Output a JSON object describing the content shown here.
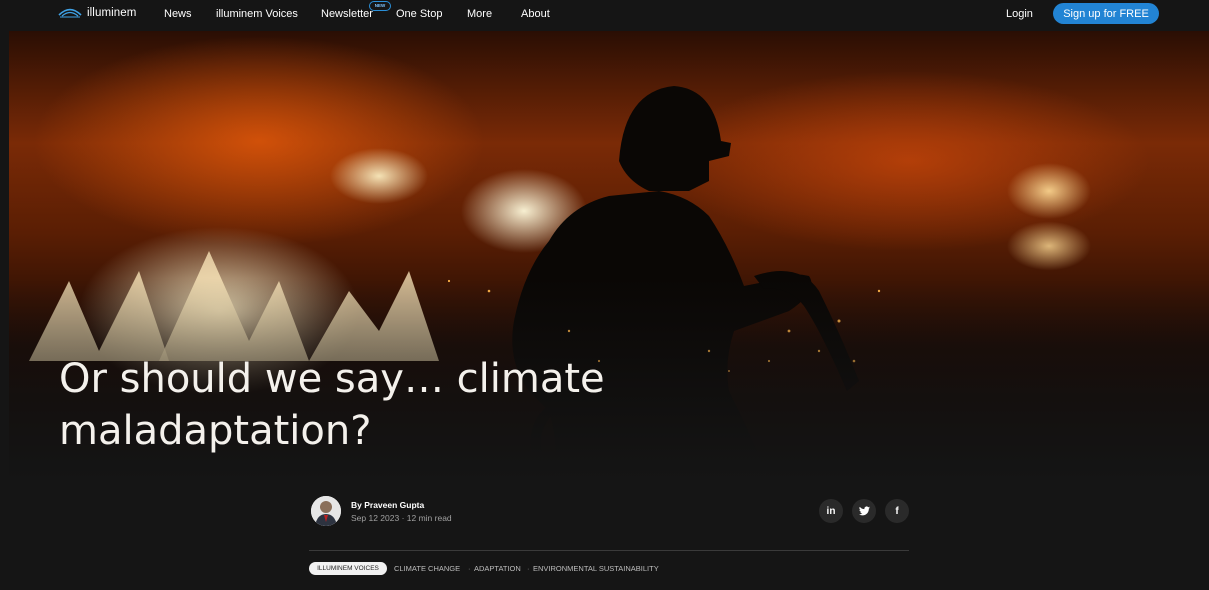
{
  "nav": {
    "logo_text": "illuminem",
    "items": [
      "News",
      "illuminem Voices",
      "Newsletter",
      "One Stop",
      "More",
      "About"
    ],
    "new_badge": "NEW",
    "login": "Login",
    "signup": "Sign up for FREE"
  },
  "article": {
    "title": "Or should we say… climate maladaptation?",
    "author": "By Praveen Gupta",
    "meta": "Sep 12 2023 · 12 min read"
  },
  "share": {
    "linkedin": "in",
    "twitter": "twitter-icon",
    "facebook": "f"
  },
  "tags": {
    "category": "ILLUMINEM VOICES",
    "topics": [
      "CLIMATE CHANGE",
      "ADAPTATION",
      "ENVIRONMENTAL SUSTAINABILITY"
    ]
  },
  "colors": {
    "accent": "#2284d4",
    "background": "#151515"
  }
}
